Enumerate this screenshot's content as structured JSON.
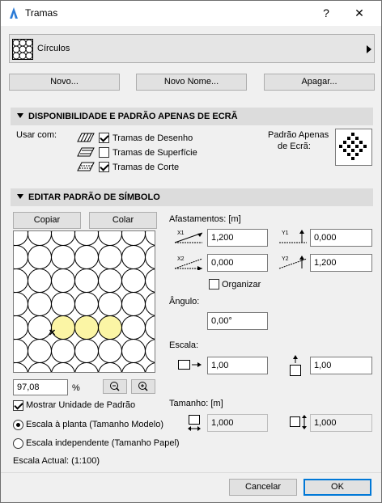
{
  "window": {
    "title": "Tramas",
    "help_label": "?",
    "close_label": "✕"
  },
  "pattern_selector": {
    "selected": "Círculos"
  },
  "top_buttons": {
    "new": "Novo...",
    "new_name": "Novo Nome...",
    "delete": "Apagar..."
  },
  "availability": {
    "header": "DISPONIBILIDADE E PADRÃO APENAS DE ECRÃ",
    "use_with_label": "Usar com:",
    "options": [
      {
        "label": "Tramas de Desenho",
        "checked": true,
        "icon": "drafting-fill-icon"
      },
      {
        "label": "Tramas de Superfície",
        "checked": false,
        "icon": "cover-fill-icon"
      },
      {
        "label": "Tramas de Corte",
        "checked": true,
        "icon": "cut-fill-icon"
      }
    ],
    "screen_pattern_label_1": "Padrão Apenas",
    "screen_pattern_label_2": "de Ecrã:"
  },
  "symbol_editor": {
    "header": "EDITAR PADRÃO DE SÍMBOLO",
    "copy": "Copiar",
    "paste": "Colar",
    "zoom_value": "97,08",
    "zoom_unit": "%",
    "show_unit_label": "Mostrar Unidade de Padrão",
    "show_unit_checked": true,
    "scale_plan_label": "Escala à planta (Tamanho Modelo)",
    "scale_independent_label": "Escala independente (Tamanho Papel)",
    "scale_plan_checked": true,
    "current_scale": "Escala Actual: (1:100)",
    "highlight_color": "#fbf5a5"
  },
  "offsets": {
    "label": "Afastamentos: [m]",
    "x1": "1,200",
    "y1": "0,000",
    "x2": "0,000",
    "y2": "1,200",
    "x1_tag": "X1",
    "y1_tag": "Y1",
    "x2_tag": "X2",
    "y2_tag": "Y2",
    "organize_label": "Organizar",
    "organize_checked": false
  },
  "angle": {
    "label": "Ângulo:",
    "value": "0,00°"
  },
  "scale": {
    "label": "Escala:",
    "x": "1,00",
    "y": "1,00"
  },
  "size": {
    "label": "Tamanho: [m]",
    "width": "1,000",
    "height": "1,000"
  },
  "footer": {
    "cancel": "Cancelar",
    "ok": "OK"
  },
  "colors": {
    "accent": "#0078d7",
    "section_bg": "#dcdcdc",
    "dialog_bg": "#f0f0f0"
  }
}
